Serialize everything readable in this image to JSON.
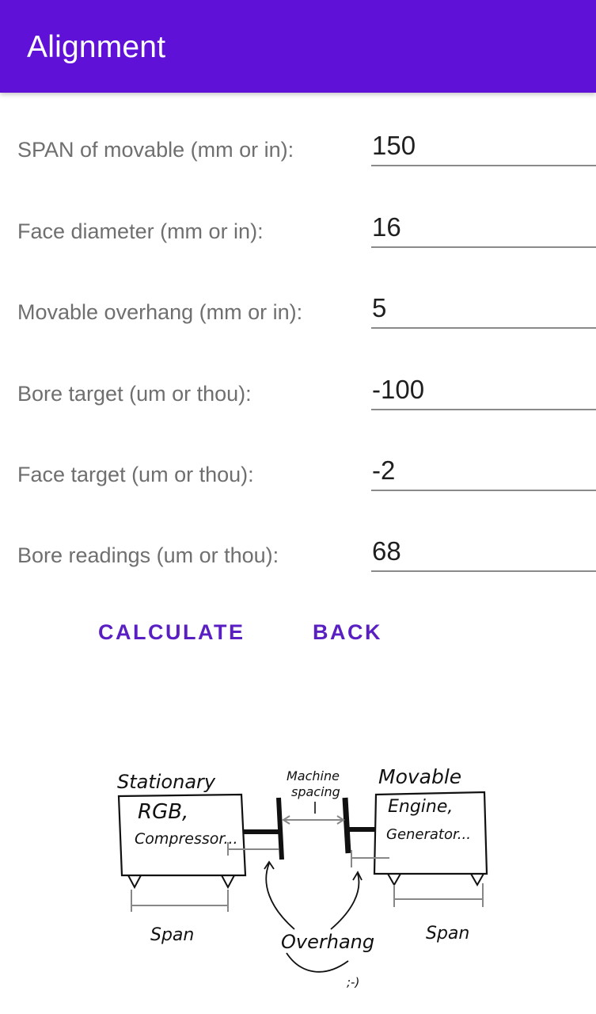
{
  "app_bar": {
    "title": "Alignment"
  },
  "form": {
    "fields": [
      {
        "label": "SPAN of movable (mm or in):",
        "value": "150"
      },
      {
        "label": "Face diameter (mm or in):",
        "value": "16"
      },
      {
        "label": "Movable overhang (mm or in):",
        "value": "5"
      },
      {
        "label": "Bore target (um or thou):",
        "value": "-100"
      },
      {
        "label": "Face target (um or thou):",
        "value": "-2"
      },
      {
        "label": "Bore readings (um or thou):",
        "value": "68"
      }
    ]
  },
  "actions": {
    "calculate_label": "CALCULATE",
    "back_label": "BACK"
  },
  "diagram": {
    "stationary_label": "Stationary",
    "stationary_line1": "RGB,",
    "stationary_line2": "Compressor...",
    "machine_spacing_line1": "Machine",
    "machine_spacing_line2": "spacing",
    "movable_label": "Movable",
    "movable_line1": "Engine,",
    "movable_line2": "Generator...",
    "span_left": "Span",
    "span_right": "Span",
    "overhang": "Overhang",
    "smiley": ";-)"
  },
  "colors": {
    "app_bar": "#6011d8",
    "button_text": "#5a1fc2",
    "label_text": "#6f6f6f"
  }
}
